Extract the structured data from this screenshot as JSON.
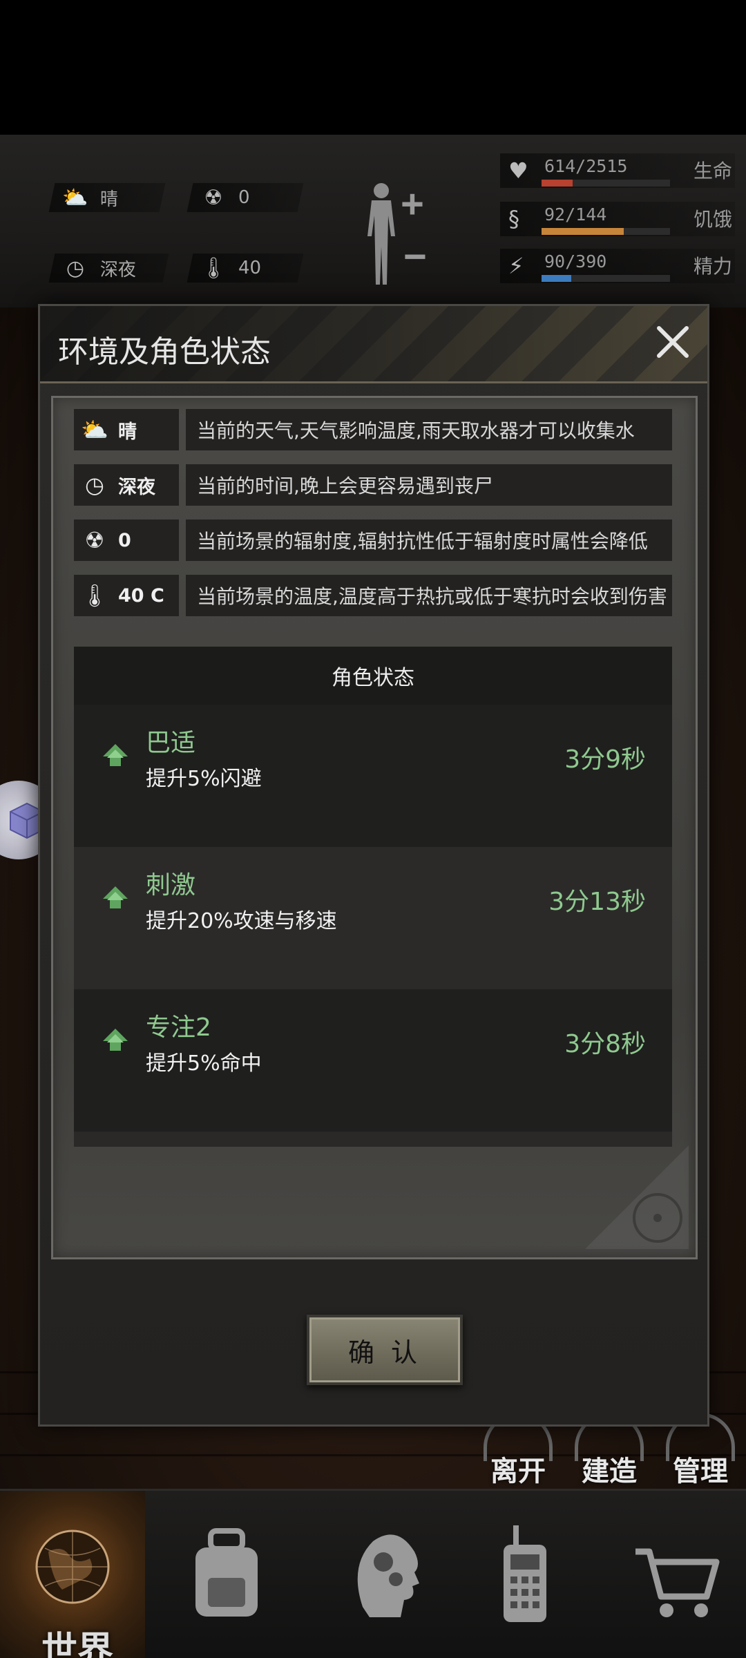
{
  "hud": {
    "weather": {
      "icon": "cloud-sun-icon",
      "value": "晴"
    },
    "radiation": {
      "icon": "radiation-icon",
      "value": "0"
    },
    "time": {
      "icon": "clock-icon",
      "value": "深夜"
    },
    "temperature": {
      "icon": "thermometer-icon",
      "value": "40"
    },
    "stats": [
      {
        "icon": "heart-icon",
        "value": "614/2515",
        "label": "生命",
        "fraction": 0.244,
        "color": "#b8412f"
      },
      {
        "icon": "stomach-icon",
        "value": "92/144",
        "label": "饥饿",
        "fraction": 0.639,
        "color": "#c7853a"
      },
      {
        "icon": "energy-icon",
        "value": "90/390",
        "label": "精力",
        "fraction": 0.231,
        "color": "#3d7dc0"
      }
    ]
  },
  "modal": {
    "title": "环境及角色状态",
    "env_rows": [
      {
        "icon": "cloud-sun-icon",
        "key": "晴",
        "desc": "当前的天气,天气影响温度,雨天取水器才可以收集水"
      },
      {
        "icon": "clock-icon",
        "key": "深夜",
        "desc": "当前的时间,晚上会更容易遇到丧尸"
      },
      {
        "icon": "radiation-icon",
        "key": "0",
        "desc": "当前场景的辐射度,辐射抗性低于辐射度时属性会降低"
      },
      {
        "icon": "thermometer-icon",
        "key": "40 C",
        "desc": "当前场景的温度,温度高于热抗或低于寒抗时会收到伤害"
      }
    ],
    "status_header": "角色状态",
    "statuses": [
      {
        "name": "巴适",
        "desc": "提升5%闪避",
        "time": "3分9秒"
      },
      {
        "name": "刺激",
        "desc": "提升20%攻速与移速",
        "time": "3分13秒"
      },
      {
        "name": "专注2",
        "desc": "提升5%命中",
        "time": "3分8秒"
      }
    ],
    "confirm": "确 认"
  },
  "actions": {
    "leave": "离开",
    "build": "建造",
    "manage": "管理"
  },
  "nav": {
    "world": "世界"
  }
}
